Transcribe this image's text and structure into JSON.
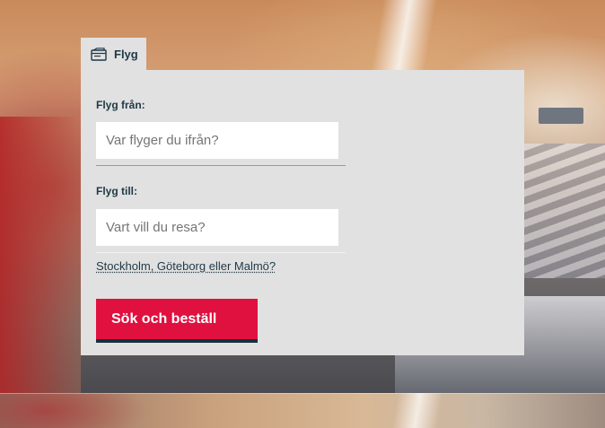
{
  "tab": {
    "label": "Flyg",
    "icon": "ticket-icon"
  },
  "form": {
    "from": {
      "label": "Flyg från:",
      "placeholder": "Var flyger du ifrån?",
      "value": ""
    },
    "to": {
      "label": "Flyg till:",
      "placeholder": "Vart vill du resa?",
      "value": ""
    },
    "suggestion_link": "Stockholm, Göteborg eller Malmö?",
    "submit_label": "Sök och beställ"
  },
  "colors": {
    "panel_bg": "#e1e1e1",
    "text_dark": "#1e3947",
    "button_bg": "#e0103f",
    "button_shadow": "#16303c"
  }
}
